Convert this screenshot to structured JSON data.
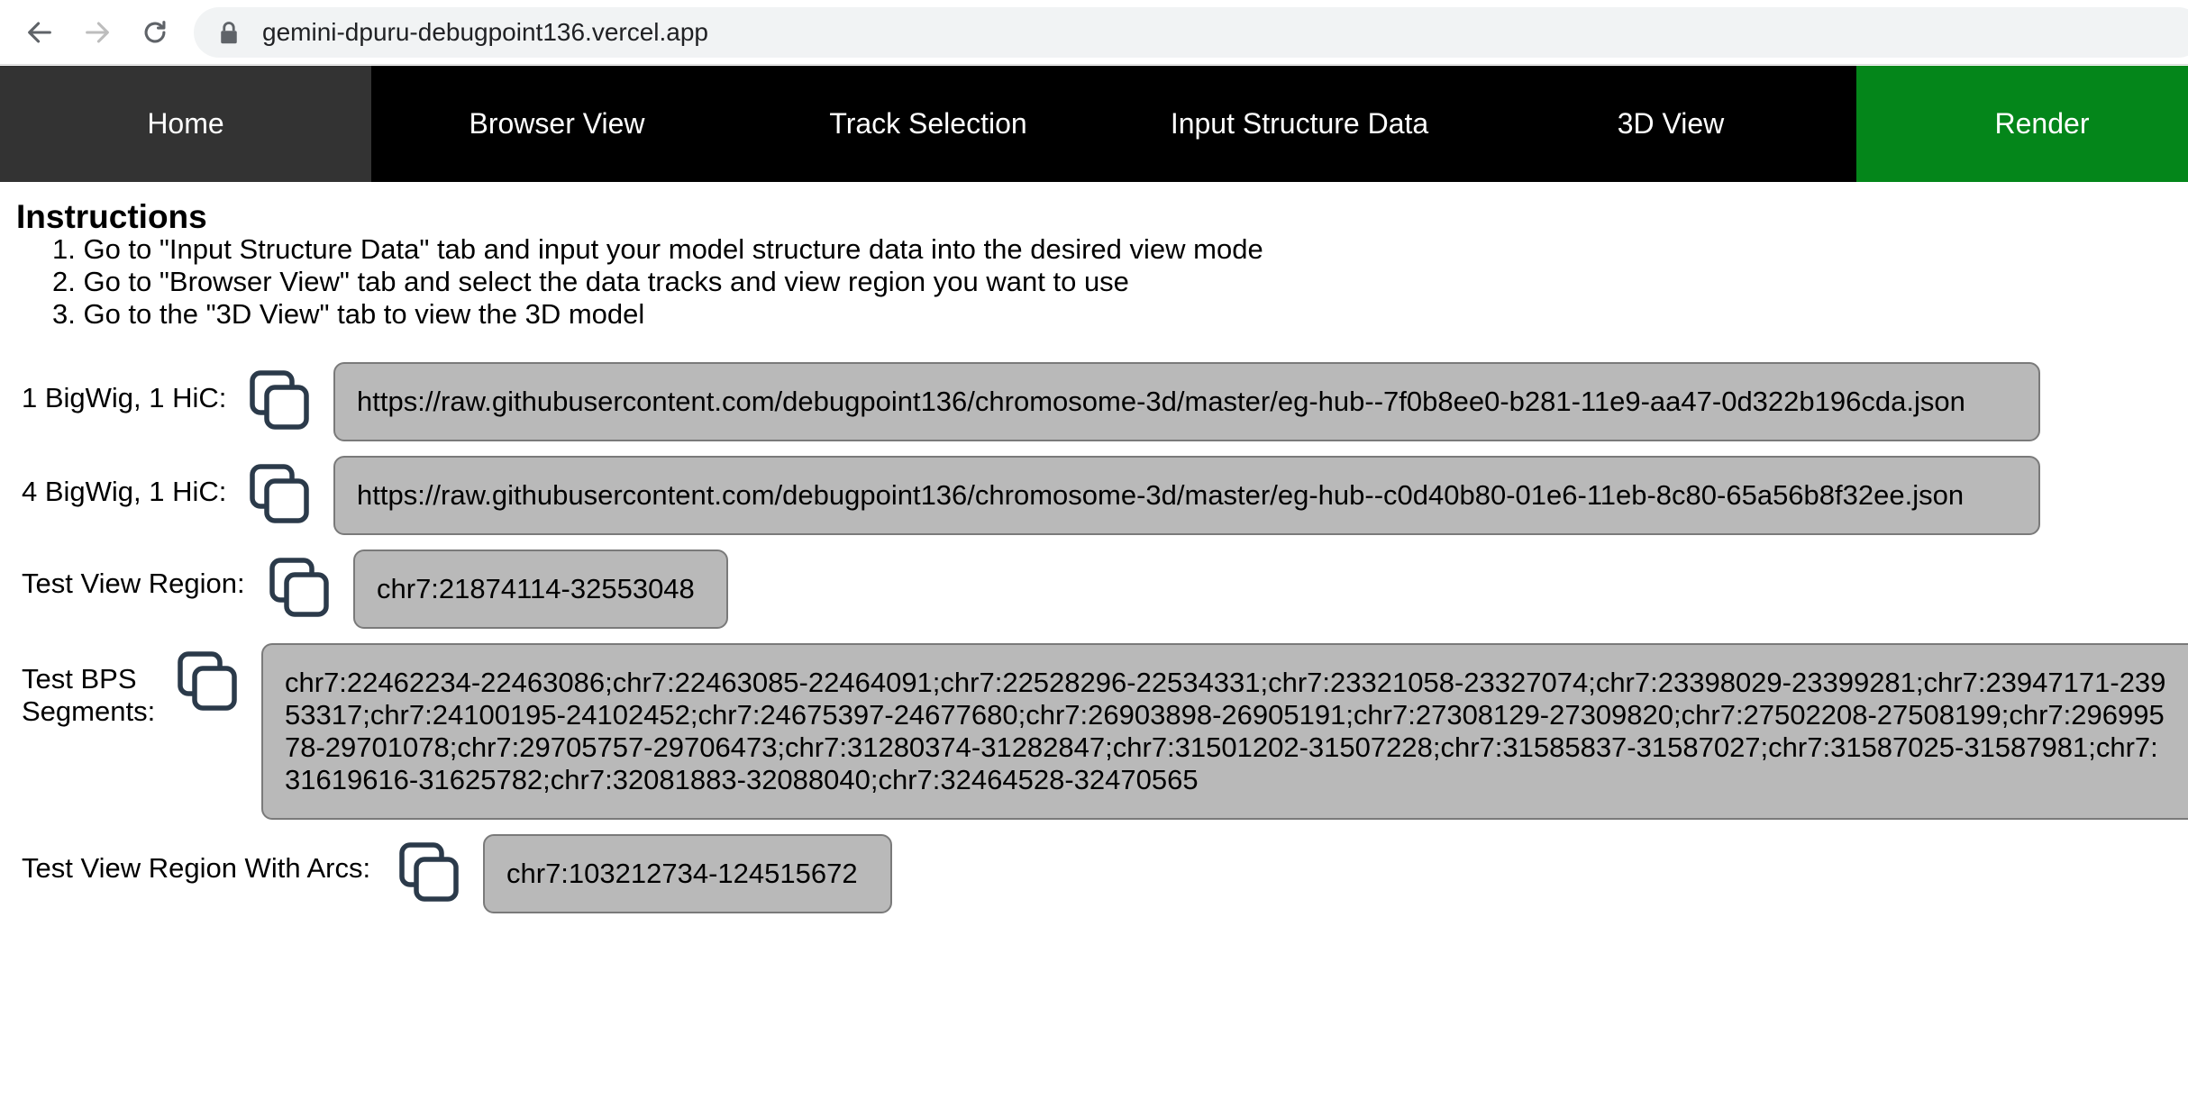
{
  "browser": {
    "url": "gemini-dpuru-debugpoint136.vercel.app"
  },
  "nav": {
    "tabs": [
      {
        "label": "Home"
      },
      {
        "label": "Browser View"
      },
      {
        "label": "Track Selection"
      },
      {
        "label": "Input Structure Data"
      },
      {
        "label": "3D View"
      },
      {
        "label": "Render"
      }
    ]
  },
  "instructions": {
    "title": "Instructions",
    "steps": [
      "1. Go to \"Input Structure Data\" tab and input your model structure data into the desired view mode",
      "2. Go to \"Browser View\" tab and select the data tracks and view region you want to use",
      "3. Go to the \"3D View\" tab to view the 3D model"
    ]
  },
  "rows": [
    {
      "label": "1 BigWig, 1 HiC:",
      "value": "https://raw.githubusercontent.com/debugpoint136/chromosome-3d/master/eg-hub--7f0b8ee0-b281-11e9-aa47-0d322b196cda.json"
    },
    {
      "label": "4 BigWig, 1 HiC:",
      "value": "https://raw.githubusercontent.com/debugpoint136/chromosome-3d/master/eg-hub--c0d40b80-01e6-11eb-8c80-65a56b8f32ee.json"
    },
    {
      "label": "Test View Region:",
      "value": "chr7:21874114-32553048"
    },
    {
      "label": "Test BPS Segments:",
      "value": "chr7:22462234-22463086;chr7:22463085-22464091;chr7:22528296-22534331;chr7:23321058-23327074;chr7:23398029-23399281;chr7:23947171-23953317;chr7:24100195-24102452;chr7:24675397-24677680;chr7:26903898-26905191;chr7:27308129-27309820;chr7:27502208-27508199;chr7:29699578-29701078;chr7:29705757-29706473;chr7:31280374-31282847;chr7:31501202-31507228;chr7:31585837-31587027;chr7:31587025-31587981;chr7:31619616-31625782;chr7:32081883-32088040;chr7:32464528-32470565"
    },
    {
      "label": "Test View Region With Arcs:",
      "value": "chr7:103212734-124515672"
    }
  ]
}
